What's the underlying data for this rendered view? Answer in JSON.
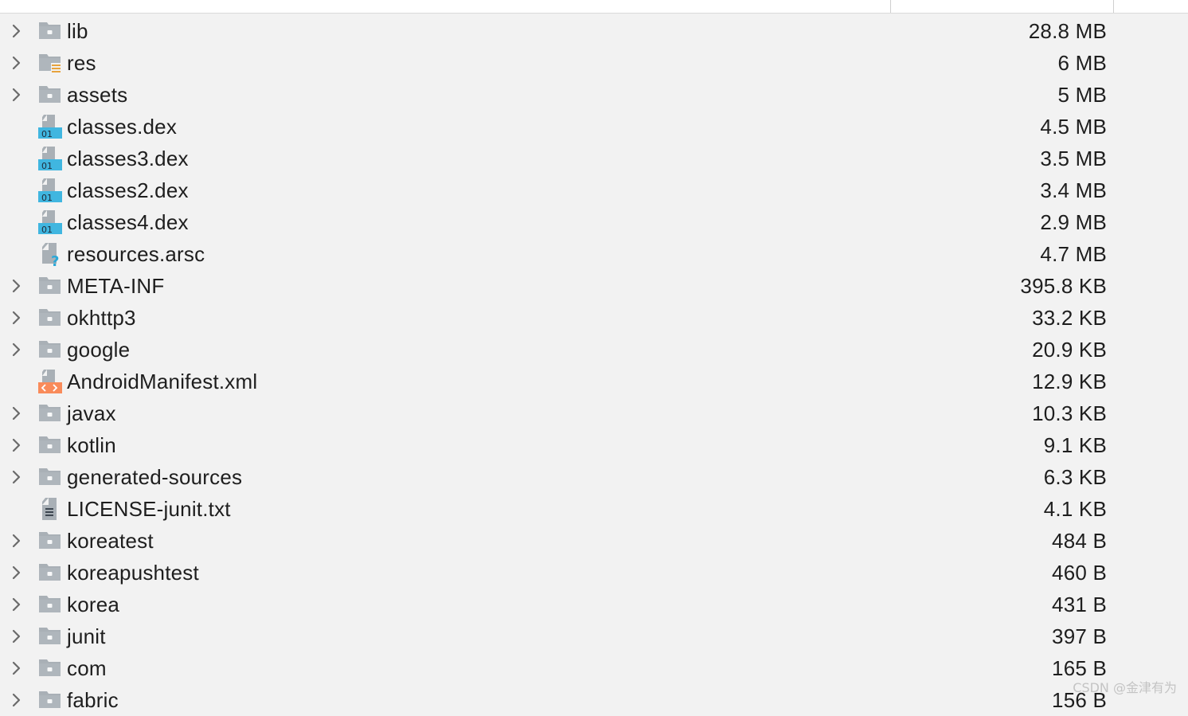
{
  "rows": [
    {
      "name": "lib",
      "size": "28.8 MB",
      "icon": "folder-icon",
      "expandable": true
    },
    {
      "name": "res",
      "size": "6 MB",
      "icon": "resource-folder-icon",
      "expandable": true
    },
    {
      "name": "assets",
      "size": "5 MB",
      "icon": "folder-icon",
      "expandable": true
    },
    {
      "name": "classes.dex",
      "size": "4.5 MB",
      "icon": "dex-file-icon",
      "expandable": false
    },
    {
      "name": "classes3.dex",
      "size": "3.5 MB",
      "icon": "dex-file-icon",
      "expandable": false
    },
    {
      "name": "classes2.dex",
      "size": "3.4 MB",
      "icon": "dex-file-icon",
      "expandable": false
    },
    {
      "name": "classes4.dex",
      "size": "2.9 MB",
      "icon": "dex-file-icon",
      "expandable": false
    },
    {
      "name": "resources.arsc",
      "size": "4.7 MB",
      "icon": "unknown-file-icon",
      "expandable": false
    },
    {
      "name": "META-INF",
      "size": "395.8 KB",
      "icon": "folder-icon",
      "expandable": true
    },
    {
      "name": "okhttp3",
      "size": "33.2 KB",
      "icon": "folder-icon",
      "expandable": true
    },
    {
      "name": "google",
      "size": "20.9 KB",
      "icon": "folder-icon",
      "expandable": true
    },
    {
      "name": "AndroidManifest.xml",
      "size": "12.9 KB",
      "icon": "xml-file-icon",
      "expandable": false
    },
    {
      "name": "javax",
      "size": "10.3 KB",
      "icon": "folder-icon",
      "expandable": true
    },
    {
      "name": "kotlin",
      "size": "9.1 KB",
      "icon": "folder-icon",
      "expandable": true
    },
    {
      "name": "generated-sources",
      "size": "6.3 KB",
      "icon": "folder-icon",
      "expandable": true
    },
    {
      "name": "LICENSE-junit.txt",
      "size": "4.1 KB",
      "icon": "text-file-icon",
      "expandable": false
    },
    {
      "name": "koreatest",
      "size": "484 B",
      "icon": "folder-icon",
      "expandable": true
    },
    {
      "name": "koreapushtest",
      "size": "460 B",
      "icon": "folder-icon",
      "expandable": true
    },
    {
      "name": "korea",
      "size": "431 B",
      "icon": "folder-icon",
      "expandable": true
    },
    {
      "name": "junit",
      "size": "397 B",
      "icon": "folder-icon",
      "expandable": true
    },
    {
      "name": "com",
      "size": "165 B",
      "icon": "folder-icon",
      "expandable": true
    },
    {
      "name": "fabric",
      "size": "156 B",
      "icon": "folder-icon",
      "expandable": true
    }
  ],
  "watermark": "CSDN @金津有为",
  "colors": {
    "background": "#f2f2f2",
    "folder": "#a9b0b6",
    "dex_badge": "#40b6e0",
    "xml_badge": "#f98b5a",
    "res_lines": "#e8a33d",
    "text": "#1e1e1e",
    "chevron": "#6b6b6b"
  }
}
